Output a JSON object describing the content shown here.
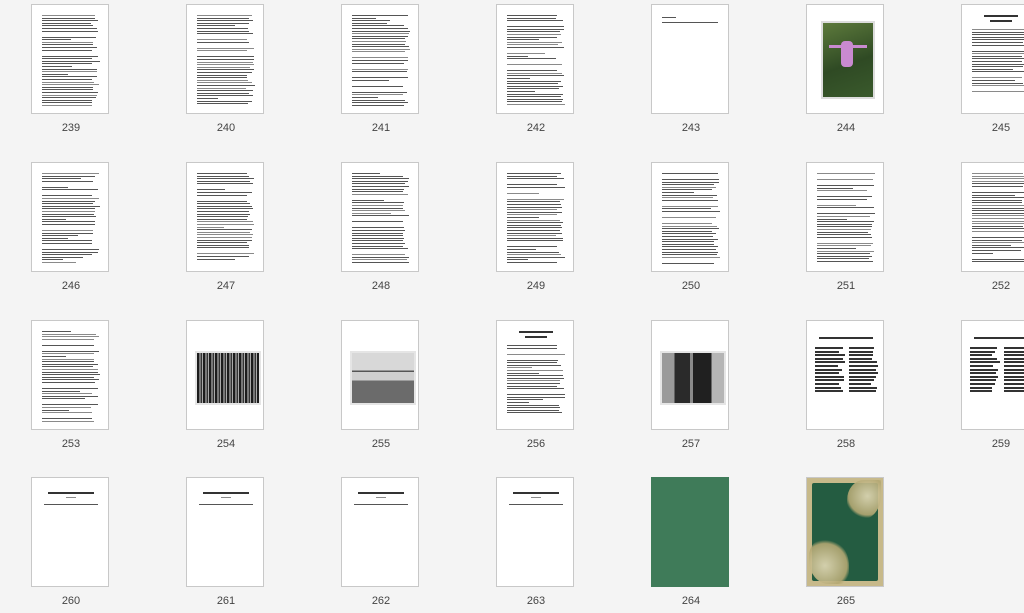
{
  "pages": [
    {
      "label": "239",
      "kind": "text"
    },
    {
      "label": "240",
      "kind": "text"
    },
    {
      "label": "241",
      "kind": "text"
    },
    {
      "label": "242",
      "kind": "text"
    },
    {
      "label": "243",
      "kind": "text-short"
    },
    {
      "label": "244",
      "kind": "photo-portrait"
    },
    {
      "label": "245",
      "kind": "text-header"
    },
    {
      "label": "246",
      "kind": "text"
    },
    {
      "label": "247",
      "kind": "text"
    },
    {
      "label": "248",
      "kind": "text"
    },
    {
      "label": "249",
      "kind": "text"
    },
    {
      "label": "250",
      "kind": "text"
    },
    {
      "label": "251",
      "kind": "text"
    },
    {
      "label": "252",
      "kind": "text"
    },
    {
      "label": "253",
      "kind": "text"
    },
    {
      "label": "254",
      "kind": "photo-landscape"
    },
    {
      "label": "255",
      "kind": "photo-landscape"
    },
    {
      "label": "256",
      "kind": "text-header"
    },
    {
      "label": "257",
      "kind": "photo-landscape"
    },
    {
      "label": "258",
      "kind": "list-columns"
    },
    {
      "label": "259",
      "kind": "list-columns"
    },
    {
      "label": "260",
      "kind": "title-only"
    },
    {
      "label": "261",
      "kind": "title-only"
    },
    {
      "label": "262",
      "kind": "title-only"
    },
    {
      "label": "263",
      "kind": "title-only"
    },
    {
      "label": "264",
      "kind": "cover-green"
    },
    {
      "label": "265",
      "kind": "cover-ornate"
    }
  ],
  "colors": {
    "background": "#f4f4f4",
    "cover_green": "#3f7b59",
    "ornate_green": "#245c41",
    "ornate_gold": "#c7b98a"
  }
}
